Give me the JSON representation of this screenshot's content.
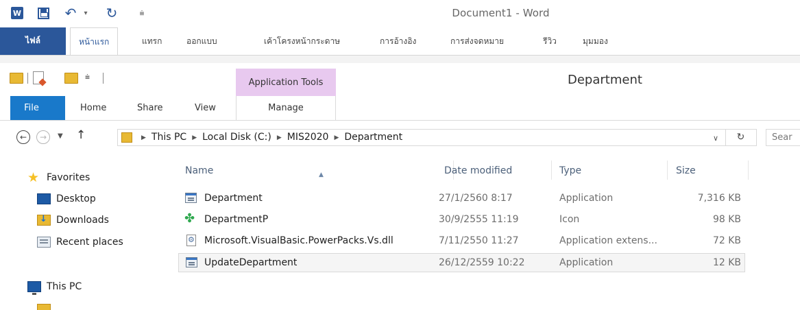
{
  "word": {
    "title": "Document1 - Word",
    "tabs": [
      "ไฟล์",
      "หน้าแรก",
      "แทรก",
      "ออกแบบ",
      "เค้าโครงหน้ากระดาษ",
      "การอ้างอิง",
      "การส่งจดหมาย",
      "รีวิว",
      "มุมมอง"
    ],
    "quick_access": [
      "word-icon",
      "save-icon",
      "undo-icon",
      "redo-icon"
    ],
    "accent": "#2b579a"
  },
  "explorer": {
    "window_title": "Department",
    "contextual_group": "Application Tools",
    "contextual_color": "#e8c9ef",
    "tabs": {
      "file": "File",
      "home": "Home",
      "share": "Share",
      "view": "View",
      "manage": "Manage"
    },
    "address": {
      "crumbs": [
        "This PC",
        "Local Disk (C:)",
        "MIS2020",
        "Department"
      ]
    },
    "search_placeholder": "Sear",
    "nav_pane": {
      "favorites": "Favorites",
      "items": [
        "Desktop",
        "Downloads",
        "Recent places"
      ],
      "this_pc": "This PC"
    },
    "columns": {
      "name": "Name",
      "date": "Date modified",
      "type": "Type",
      "size": "Size"
    },
    "files": [
      {
        "name": "Department",
        "date": "27/1/2560 8:17",
        "type": "Application",
        "size": "7,316 KB",
        "icon": "application-icon"
      },
      {
        "name": "DepartmentP",
        "date": "30/9/2555 11:19",
        "type": "Icon",
        "size": "98 KB",
        "icon": "clover-icon"
      },
      {
        "name": "Microsoft.VisualBasic.PowerPacks.Vs.dll",
        "date": "7/11/2550 11:27",
        "type": "Application extens...",
        "size": "72 KB",
        "icon": "dll-icon"
      },
      {
        "name": "UpdateDepartment",
        "date": "26/12/2559 10:22",
        "type": "Application",
        "size": "12 KB",
        "icon": "application-icon"
      }
    ]
  }
}
